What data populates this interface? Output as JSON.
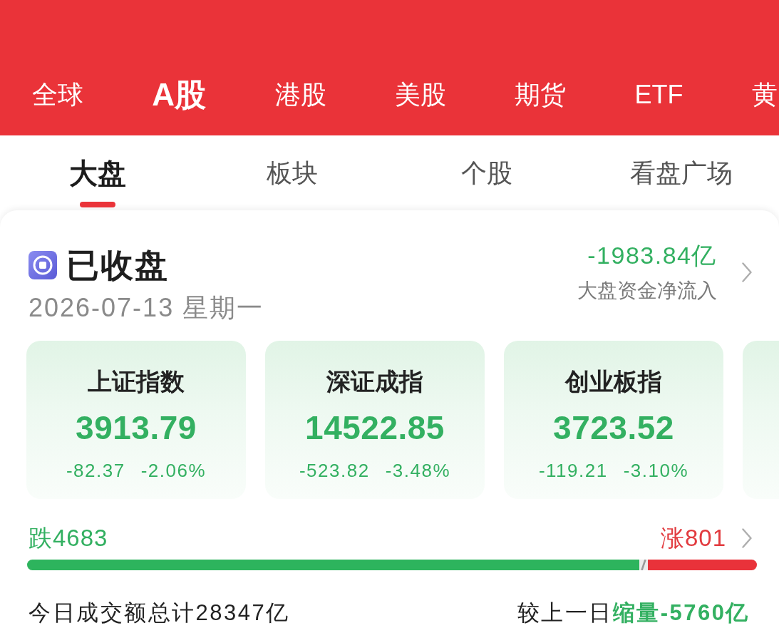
{
  "market_tabs": [
    {
      "label": "全球",
      "selected": false
    },
    {
      "label": "A股",
      "selected": true
    },
    {
      "label": "港股",
      "selected": false
    },
    {
      "label": "美股",
      "selected": false
    },
    {
      "label": "期货",
      "selected": false
    },
    {
      "label": "ETF",
      "selected": false
    },
    {
      "label": "黄",
      "selected": false
    }
  ],
  "sub_tabs": [
    {
      "label": "大盘",
      "selected": true
    },
    {
      "label": "板块",
      "selected": false
    },
    {
      "label": "个股",
      "selected": false
    },
    {
      "label": "看盘广场",
      "selected": false
    }
  ],
  "market_status": {
    "title": "已收盘",
    "date": "2026-07-13 星期一"
  },
  "fund_flow": {
    "value": "-1983.84亿",
    "label": "大盘资金净流入",
    "rising": false
  },
  "indices": [
    {
      "kind": "index",
      "name": "上证指数",
      "value": "3913.79",
      "change": "-82.37",
      "change_pct": "-2.06%",
      "rising": false
    },
    {
      "kind": "index",
      "name": "深证成指",
      "value": "14522.85",
      "change": "-523.82",
      "change_pct": "-3.48%",
      "rising": false
    },
    {
      "kind": "index",
      "name": "创业板指",
      "value": "3723.52",
      "change": "-119.21",
      "change_pct": "-3.10%",
      "rising": false
    },
    {
      "kind": "clipped"
    }
  ],
  "breadth": {
    "falling": "跌4683",
    "rising": "涨801",
    "level": 0.845
  },
  "turnover": {
    "total": "今日成交额总计28347亿",
    "compare_label": "较上一日",
    "compare_value": "缩量-5760亿",
    "compare_rising": false
  }
}
